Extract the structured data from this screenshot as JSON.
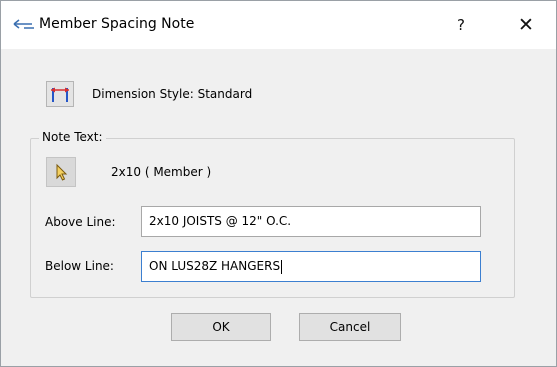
{
  "window": {
    "title": "Member Spacing Note",
    "help_glyph": "?",
    "close_glyph": "✕"
  },
  "dimension_style": {
    "label": "Dimension Style: Standard",
    "icon": "dimension-style-icon"
  },
  "note_text": {
    "group_label": "Note Text:",
    "pick_icon": "cursor-pick-icon",
    "member_label": "2x10 ( Member )",
    "above_line_label": "Above Line:",
    "above_line_value": "2x10 JOISTS @ 12\" O.C.",
    "below_line_label": "Below Line:",
    "below_line_value": "ON LUS28Z HANGERS"
  },
  "buttons": {
    "ok_label": "OK",
    "cancel_label": "Cancel"
  },
  "colors": {
    "dialog_bg": "#f0f0f0",
    "focus_border": "#3c7fd0",
    "dimension_icon_red": "#d83030",
    "dimension_icon_blue": "#2456c8"
  }
}
